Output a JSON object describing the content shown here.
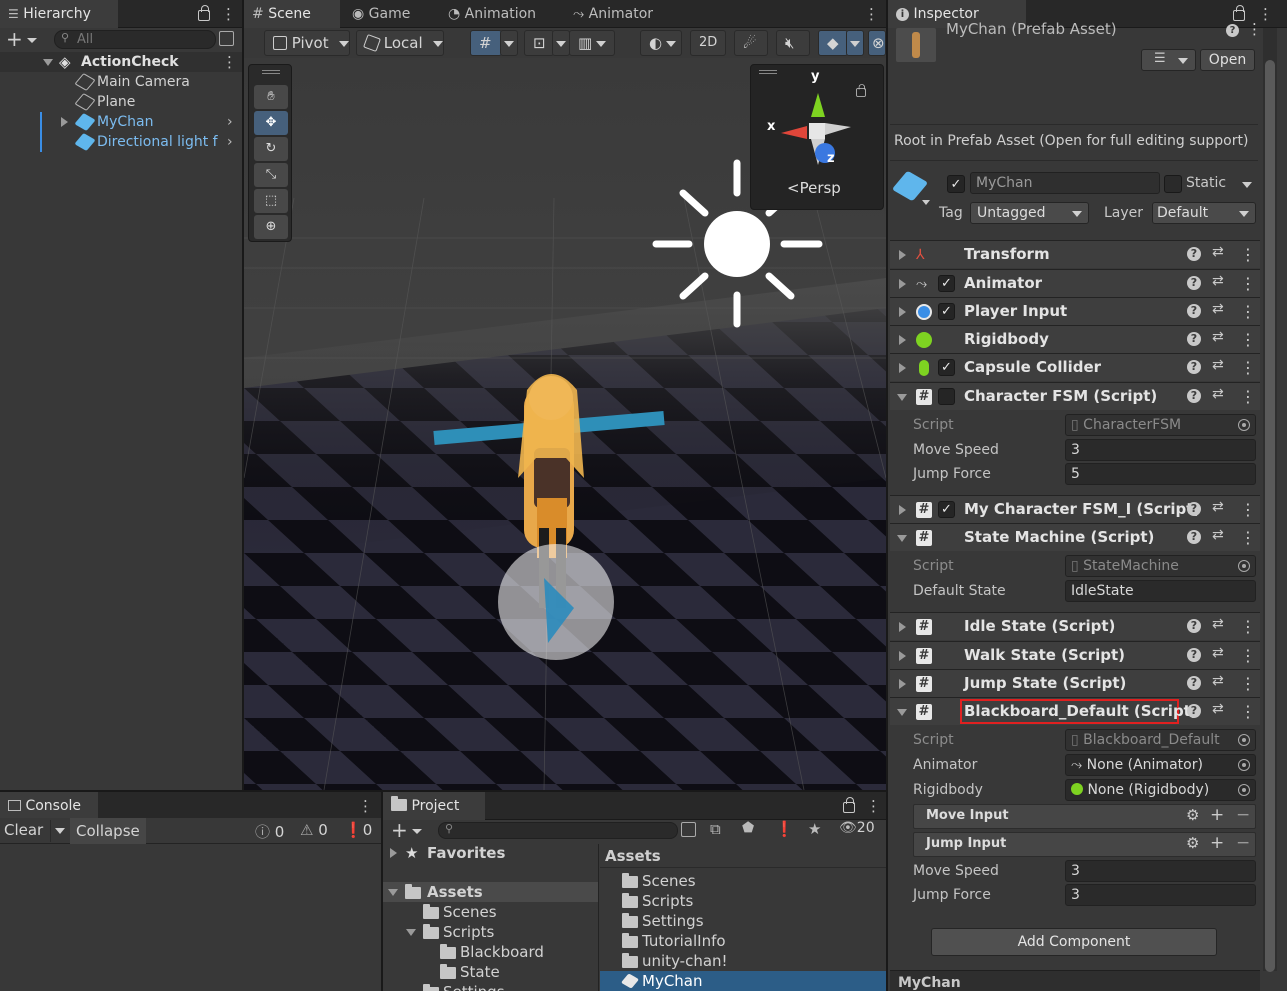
{
  "hierarchy": {
    "tab_label": "Hierarchy",
    "search_placeholder": "All",
    "root": "ActionCheck",
    "items": [
      {
        "label": "Main Camera"
      },
      {
        "label": "Plane"
      },
      {
        "label": "MyChan"
      },
      {
        "label": "Directional light f"
      }
    ]
  },
  "scene": {
    "tabs": [
      "Scene",
      "Game",
      "Animation",
      "Animator"
    ],
    "pivot_label": "Pivot",
    "local_label": "Local",
    "twod_label": "2D",
    "gizmo": {
      "x": "x",
      "y": "y",
      "z": "z",
      "persp_label": "Persp"
    }
  },
  "inspector": {
    "tab_label": "Inspector",
    "asset_title": "MyChan (Prefab Asset)",
    "open_label": "Open",
    "notice": "Root in Prefab Asset (Open for full editing support)",
    "object_name": "MyChan",
    "static_label": "Static",
    "tag_label": "Tag",
    "tag_value": "Untagged",
    "layer_label": "Layer",
    "layer_value": "Default",
    "components": {
      "transform": "Transform",
      "animator": "Animator",
      "player_input": "Player Input",
      "rigidbody": "Rigidbody",
      "capsule": "Capsule Collider",
      "character_fsm": "Character FSM (Script)",
      "my_fsm": "My Character FSM_I (Script)",
      "state_machine": "State Machine (Script)",
      "idle": "Idle State (Script)",
      "walk": "Walk State (Script)",
      "jump": "Jump State (Script)",
      "blackboard": "Blackboard_Default (Script)"
    },
    "fsm": {
      "script_label": "Script",
      "script_value": "CharacterFSM",
      "move_label": "Move Speed",
      "move_value": "3",
      "jump_label": "Jump Force",
      "jump_value": "5"
    },
    "sm": {
      "script_label": "Script",
      "script_value": "StateMachine",
      "default_label": "Default State",
      "default_value": "IdleState"
    },
    "bb": {
      "script_label": "Script",
      "script_value": "Blackboard_Default",
      "animator_label": "Animator",
      "animator_value": "None (Animator)",
      "rigidbody_label": "Rigidbody",
      "rigidbody_value": "None (Rigidbody)",
      "move_input": "Move Input",
      "jump_input": "Jump Input",
      "move_label": "Move Speed",
      "move_value": "3",
      "jump_label": "Jump Force",
      "jump_value": "3"
    },
    "add_component": "Add Component",
    "footer": "MyChan"
  },
  "console": {
    "tab_label": "Console",
    "clear_label": "Clear",
    "collapse_label": "Collapse",
    "info_count": "0",
    "warn_count": "0",
    "error_count": "0"
  },
  "project": {
    "tab_label": "Project",
    "hidden_count": "20",
    "favorites": "Favorites",
    "tree": {
      "assets": "Assets",
      "scenes": "Scenes",
      "scripts": "Scripts",
      "blackboard": "Blackboard",
      "state": "State",
      "settings": "Settings"
    },
    "assets_header": "Assets",
    "assets_list": [
      "Scenes",
      "Scripts",
      "Settings",
      "TutorialInfo",
      "unity-chan!",
      "MyChan"
    ]
  }
}
